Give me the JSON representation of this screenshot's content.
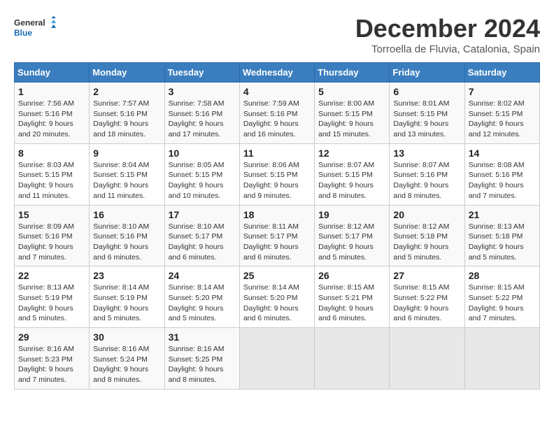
{
  "header": {
    "logo_line1": "General",
    "logo_line2": "Blue",
    "month_title": "December 2024",
    "location": "Torroella de Fluvia, Catalonia, Spain"
  },
  "days_of_week": [
    "Sunday",
    "Monday",
    "Tuesday",
    "Wednesday",
    "Thursday",
    "Friday",
    "Saturday"
  ],
  "weeks": [
    [
      {
        "day": "1",
        "sunrise": "7:56 AM",
        "sunset": "5:16 PM",
        "daylight": "9 hours and 20 minutes"
      },
      {
        "day": "2",
        "sunrise": "7:57 AM",
        "sunset": "5:16 PM",
        "daylight": "9 hours and 18 minutes"
      },
      {
        "day": "3",
        "sunrise": "7:58 AM",
        "sunset": "5:16 PM",
        "daylight": "9 hours and 17 minutes"
      },
      {
        "day": "4",
        "sunrise": "7:59 AM",
        "sunset": "5:16 PM",
        "daylight": "9 hours and 16 minutes"
      },
      {
        "day": "5",
        "sunrise": "8:00 AM",
        "sunset": "5:15 PM",
        "daylight": "9 hours and 15 minutes"
      },
      {
        "day": "6",
        "sunrise": "8:01 AM",
        "sunset": "5:15 PM",
        "daylight": "9 hours and 13 minutes"
      },
      {
        "day": "7",
        "sunrise": "8:02 AM",
        "sunset": "5:15 PM",
        "daylight": "9 hours and 12 minutes"
      }
    ],
    [
      {
        "day": "8",
        "sunrise": "8:03 AM",
        "sunset": "5:15 PM",
        "daylight": "9 hours and 11 minutes"
      },
      {
        "day": "9",
        "sunrise": "8:04 AM",
        "sunset": "5:15 PM",
        "daylight": "9 hours and 11 minutes"
      },
      {
        "day": "10",
        "sunrise": "8:05 AM",
        "sunset": "5:15 PM",
        "daylight": "9 hours and 10 minutes"
      },
      {
        "day": "11",
        "sunrise": "8:06 AM",
        "sunset": "5:15 PM",
        "daylight": "9 hours and 9 minutes"
      },
      {
        "day": "12",
        "sunrise": "8:07 AM",
        "sunset": "5:15 PM",
        "daylight": "9 hours and 8 minutes"
      },
      {
        "day": "13",
        "sunrise": "8:07 AM",
        "sunset": "5:16 PM",
        "daylight": "9 hours and 8 minutes"
      },
      {
        "day": "14",
        "sunrise": "8:08 AM",
        "sunset": "5:16 PM",
        "daylight": "9 hours and 7 minutes"
      }
    ],
    [
      {
        "day": "15",
        "sunrise": "8:09 AM",
        "sunset": "5:16 PM",
        "daylight": "9 hours and 7 minutes"
      },
      {
        "day": "16",
        "sunrise": "8:10 AM",
        "sunset": "5:16 PM",
        "daylight": "9 hours and 6 minutes"
      },
      {
        "day": "17",
        "sunrise": "8:10 AM",
        "sunset": "5:17 PM",
        "daylight": "9 hours and 6 minutes"
      },
      {
        "day": "18",
        "sunrise": "8:11 AM",
        "sunset": "5:17 PM",
        "daylight": "9 hours and 6 minutes"
      },
      {
        "day": "19",
        "sunrise": "8:12 AM",
        "sunset": "5:17 PM",
        "daylight": "9 hours and 5 minutes"
      },
      {
        "day": "20",
        "sunrise": "8:12 AM",
        "sunset": "5:18 PM",
        "daylight": "9 hours and 5 minutes"
      },
      {
        "day": "21",
        "sunrise": "8:13 AM",
        "sunset": "5:18 PM",
        "daylight": "9 hours and 5 minutes"
      }
    ],
    [
      {
        "day": "22",
        "sunrise": "8:13 AM",
        "sunset": "5:19 PM",
        "daylight": "9 hours and 5 minutes"
      },
      {
        "day": "23",
        "sunrise": "8:14 AM",
        "sunset": "5:19 PM",
        "daylight": "9 hours and 5 minutes"
      },
      {
        "day": "24",
        "sunrise": "8:14 AM",
        "sunset": "5:20 PM",
        "daylight": "9 hours and 5 minutes"
      },
      {
        "day": "25",
        "sunrise": "8:14 AM",
        "sunset": "5:20 PM",
        "daylight": "9 hours and 6 minutes"
      },
      {
        "day": "26",
        "sunrise": "8:15 AM",
        "sunset": "5:21 PM",
        "daylight": "9 hours and 6 minutes"
      },
      {
        "day": "27",
        "sunrise": "8:15 AM",
        "sunset": "5:22 PM",
        "daylight": "9 hours and 6 minutes"
      },
      {
        "day": "28",
        "sunrise": "8:15 AM",
        "sunset": "5:22 PM",
        "daylight": "9 hours and 7 minutes"
      }
    ],
    [
      {
        "day": "29",
        "sunrise": "8:16 AM",
        "sunset": "5:23 PM",
        "daylight": "9 hours and 7 minutes"
      },
      {
        "day": "30",
        "sunrise": "8:16 AM",
        "sunset": "5:24 PM",
        "daylight": "9 hours and 8 minutes"
      },
      {
        "day": "31",
        "sunrise": "8:16 AM",
        "sunset": "5:25 PM",
        "daylight": "9 hours and 8 minutes"
      },
      null,
      null,
      null,
      null
    ]
  ]
}
